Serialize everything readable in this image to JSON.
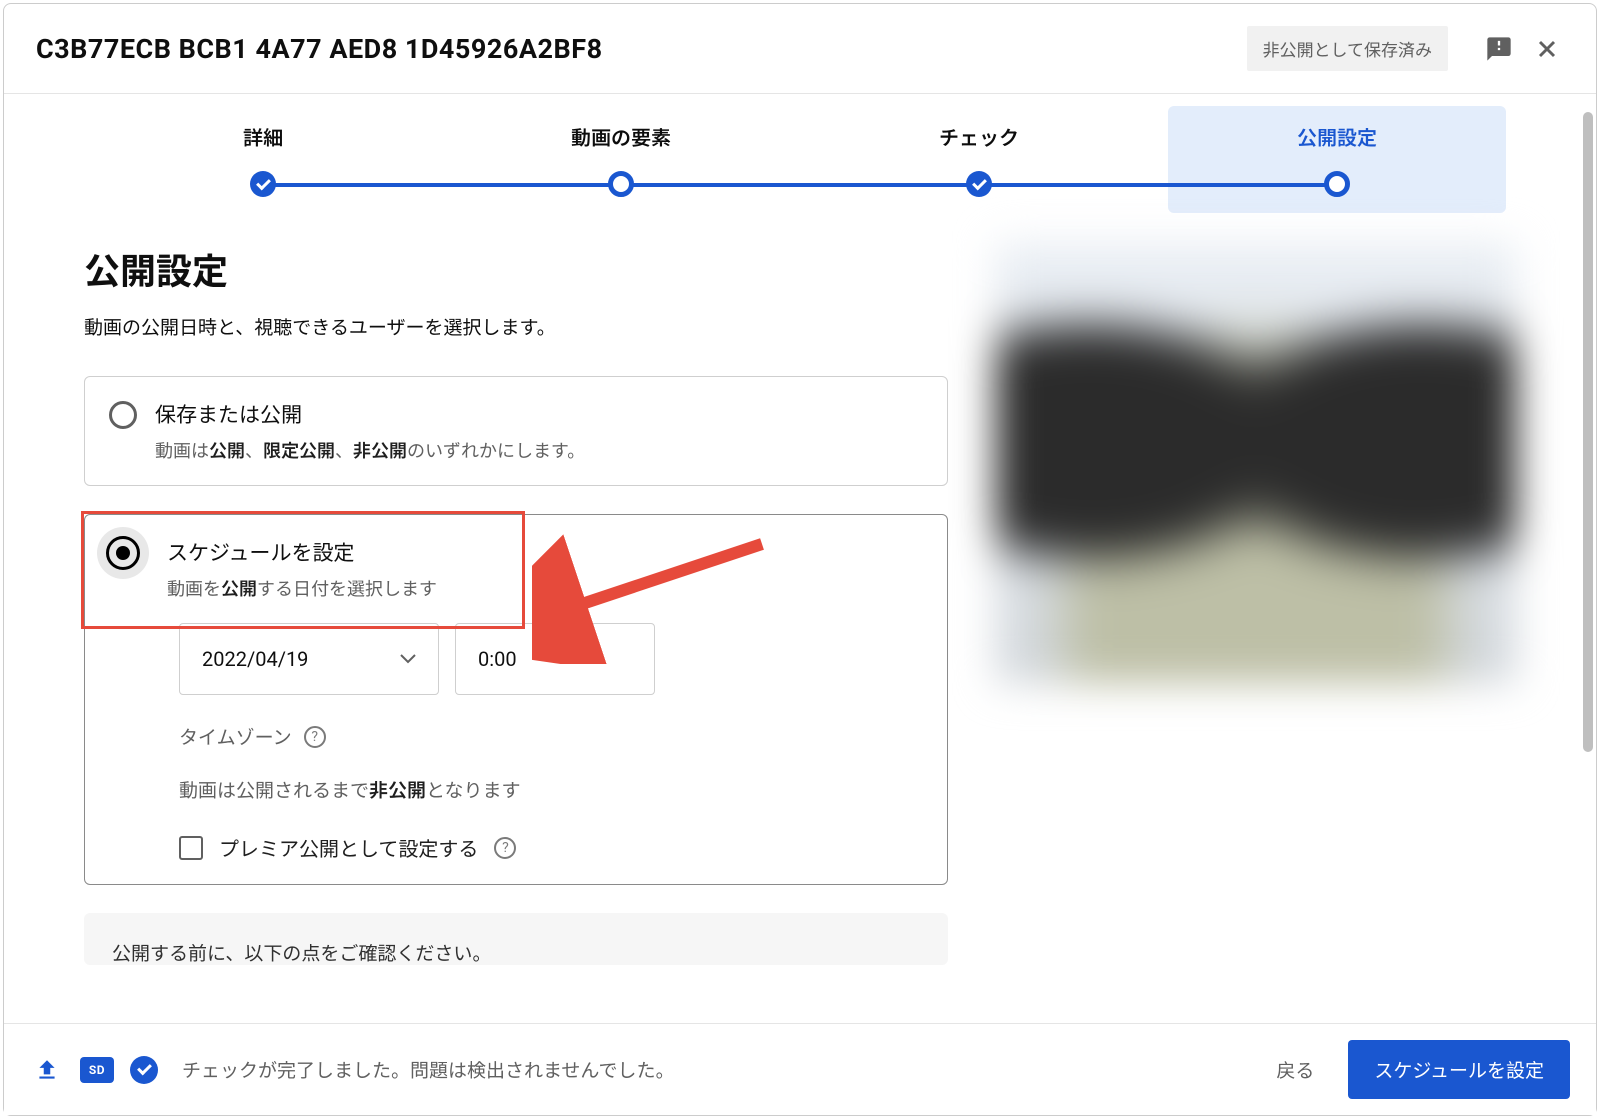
{
  "header": {
    "title": "C3B77ECB BCB1 4A77 AED8 1D45926A2BF8",
    "save_status": "非公開として保存済み"
  },
  "stepper": {
    "steps": [
      {
        "label": "詳細",
        "state": "done"
      },
      {
        "label": "動画の要素",
        "state": "current-open"
      },
      {
        "label": "チェック",
        "state": "done"
      },
      {
        "label": "公開設定",
        "state": "active"
      }
    ]
  },
  "section": {
    "title": "公開設定",
    "subtitle": "動画の公開日時と、視聴できるユーザーを選択します。"
  },
  "option_publish": {
    "title": "保存または公開",
    "desc_prefix": "動画は",
    "desc_b1": "公開",
    "desc_sep1": "、",
    "desc_b2": "限定公開",
    "desc_sep2": "、",
    "desc_b3": "非公開",
    "desc_suffix": "のいずれかにします。"
  },
  "option_schedule": {
    "title": "スケジュールを設定",
    "desc_prefix": "動画を",
    "desc_b1": "公開",
    "desc_suffix": "する日付を選択します",
    "date_value": "2022/04/19",
    "time_value": "0:00",
    "timezone_label": "タイムゾーン",
    "private_note_prefix": "動画は公開されるまで",
    "private_note_b": "非公開",
    "private_note_suffix": "となります",
    "premiere_label": "プレミア公開として設定する"
  },
  "extra_card": {
    "text": "公開する前に、以下の点をご確認ください。"
  },
  "footer": {
    "sd_badge": "SD",
    "check_msg": "チェックが完了しました。問題は検出されませんでした。",
    "back_label": "戻る",
    "primary_label": "スケジュールを設定"
  }
}
